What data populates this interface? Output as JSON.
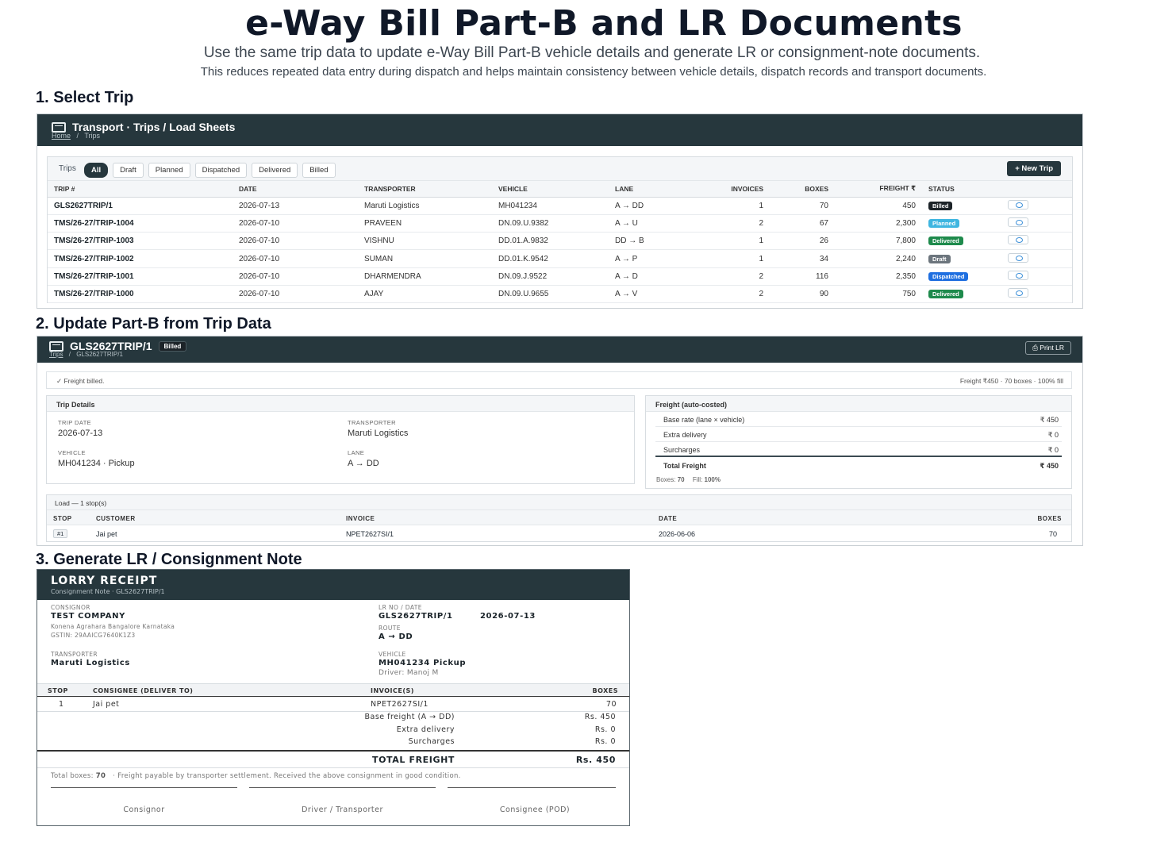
{
  "header": {
    "title": "e-Way Bill Part-B and LR Documents",
    "subtitle": "Use the same trip data to update e-Way Bill Part-B vehicle details and generate LR or consignment-note documents.",
    "subtitle2": "This reduces repeated data entry during dispatch and helps maintain consistency between vehicle details, dispatch records and transport documents."
  },
  "section1": {
    "heading": "1. Select Trip",
    "panel_title": "Transport · Trips / Load Sheets",
    "breadcrumb_home": "Home",
    "breadcrumb_sep": "/",
    "breadcrumb_current": "Trips",
    "filter_label": "Trips",
    "filters": [
      "All",
      "Draft",
      "Planned",
      "Dispatched",
      "Delivered",
      "Billed"
    ],
    "active_filter": "All",
    "new_trip_label": "+ New Trip",
    "columns": [
      "TRIP #",
      "DATE",
      "TRANSPORTER",
      "VEHICLE",
      "LANE",
      "INVOICES",
      "BOXES",
      "FREIGHT ₹",
      "STATUS"
    ],
    "rows": [
      {
        "trip": "GLS2627TRIP/1",
        "date": "2026-07-13",
        "transporter": "Maruti Logistics",
        "vehicle": "MH041234",
        "lane": "A → DD",
        "invoices": "1",
        "boxes": "70",
        "freight": "450",
        "status": "Billed"
      },
      {
        "trip": "TMS/26-27/TRIP-1004",
        "date": "2026-07-10",
        "transporter": "PRAVEEN",
        "vehicle": "DN.09.U.9382",
        "lane": "A → U",
        "invoices": "2",
        "boxes": "67",
        "freight": "2,300",
        "status": "Planned"
      },
      {
        "trip": "TMS/26-27/TRIP-1003",
        "date": "2026-07-10",
        "transporter": "VISHNU",
        "vehicle": "DD.01.A.9832",
        "lane": "DD → B",
        "invoices": "1",
        "boxes": "26",
        "freight": "7,800",
        "status": "Delivered"
      },
      {
        "trip": "TMS/26-27/TRIP-1002",
        "date": "2026-07-10",
        "transporter": "SUMAN",
        "vehicle": "DD.01.K.9542",
        "lane": "A → P",
        "invoices": "1",
        "boxes": "34",
        "freight": "2,240",
        "status": "Draft"
      },
      {
        "trip": "TMS/26-27/TRIP-1001",
        "date": "2026-07-10",
        "transporter": "DHARMENDRA",
        "vehicle": "DN.09.J.9522",
        "lane": "A → D",
        "invoices": "2",
        "boxes": "116",
        "freight": "2,350",
        "status": "Dispatched"
      },
      {
        "trip": "TMS/26-27/TRIP-1000",
        "date": "2026-07-10",
        "transporter": "AJAY",
        "vehicle": "DN.09.U.9655",
        "lane": "A → V",
        "invoices": "2",
        "boxes": "90",
        "freight": "750",
        "status": "Delivered"
      }
    ],
    "status_colors": {
      "Billed": "#1c2328",
      "Planned": "#3fb6e0",
      "Delivered": "#1e8a4c",
      "Draft": "#6c757d",
      "Dispatched": "#1f6fe0"
    }
  },
  "section2": {
    "heading": "2. Update Part-B from Trip Data",
    "panel_title": "GLS2627TRIP/1",
    "status_badge": "Billed",
    "breadcrumb_link": "Trips",
    "breadcrumb_sep": "/",
    "breadcrumb_current": "GLS2627TRIP/1",
    "print_label": "Print LR",
    "notice_left": "✓ Freight billed.",
    "notice_right": "Freight ₹450 · 70 boxes · 100% fill",
    "trip_details_title": "Trip Details",
    "trip_date_label": "TRIP DATE",
    "trip_date": "2026-07-13",
    "transporter_label": "TRANSPORTER",
    "transporter": "Maruti Logistics",
    "vehicle_label": "VEHICLE",
    "vehicle": "MH041234 · Pickup",
    "lane_label": "LANE",
    "lane": "A → DD",
    "freight_title": "Freight (auto-costed)",
    "freight_rows": [
      {
        "label": "Base rate (lane × vehicle)",
        "value": "₹ 450"
      },
      {
        "label": "Extra delivery",
        "value": "₹ 0"
      },
      {
        "label": "Surcharges",
        "value": "₹ 0"
      }
    ],
    "total_label": "Total Freight",
    "total_value": "₹ 450",
    "boxes_label": "Boxes:",
    "boxes_value": "70",
    "fill_label": "Fill:",
    "fill_value": "100%",
    "load_title": "Load — 1 stop(s)",
    "load_columns": [
      "STOP",
      "CUSTOMER",
      "INVOICE",
      "DATE",
      "BOXES"
    ],
    "load_rows": [
      {
        "stop": "#1",
        "customer": "Jai pet",
        "invoice": "NPET2627SI/1",
        "date": "2026-06-06",
        "boxes": "70"
      }
    ]
  },
  "section3": {
    "heading": "3. Generate LR / Consignment Note",
    "title": "LORRY RECEIPT",
    "subtitle": "Consignment Note  ·  GLS2627TRIP/1",
    "consignor_label": "CONSIGNOR",
    "consignor_name": "TEST COMPANY",
    "consignor_address": "Konena Agrahara Bangalore Karnataka",
    "consignor_gstin": "GSTIN: 29AAICG7640K1Z3",
    "lr_label": "LR NO / DATE",
    "lr_no": "GLS2627TRIP/1",
    "lr_date": "2026-07-13",
    "route_label": "ROUTE",
    "route": "A → DD",
    "transporter_label": "TRANSPORTER",
    "transporter": "Maruti Logistics",
    "vehicle_label": "VEHICLE",
    "vehicle": "MH041234 Pickup",
    "driver": "Driver: Manoj M",
    "columns": [
      "STOP",
      "CONSIGNEE (DELIVER TO)",
      "INVOICE(S)",
      "BOXES"
    ],
    "rows": [
      {
        "stop": "1",
        "consignee": "Jai pet",
        "invoice": "NPET2627SI/1",
        "boxes": "70"
      }
    ],
    "charges": [
      {
        "label": "Base freight (A → DD)",
        "value": "Rs. 450"
      },
      {
        "label": "Extra delivery",
        "value": "Rs. 0"
      },
      {
        "label": "Surcharges",
        "value": "Rs. 0"
      }
    ],
    "total_label": "TOTAL FREIGHT",
    "total_value": "Rs. 450",
    "footer_boxes_label": "Total boxes:",
    "footer_boxes_value": "70",
    "footer_note": "·  Freight payable by transporter settlement. Received the above consignment in good condition.",
    "signatures": [
      "Consignor",
      "Driver / Transporter",
      "Consignee (POD)"
    ]
  }
}
